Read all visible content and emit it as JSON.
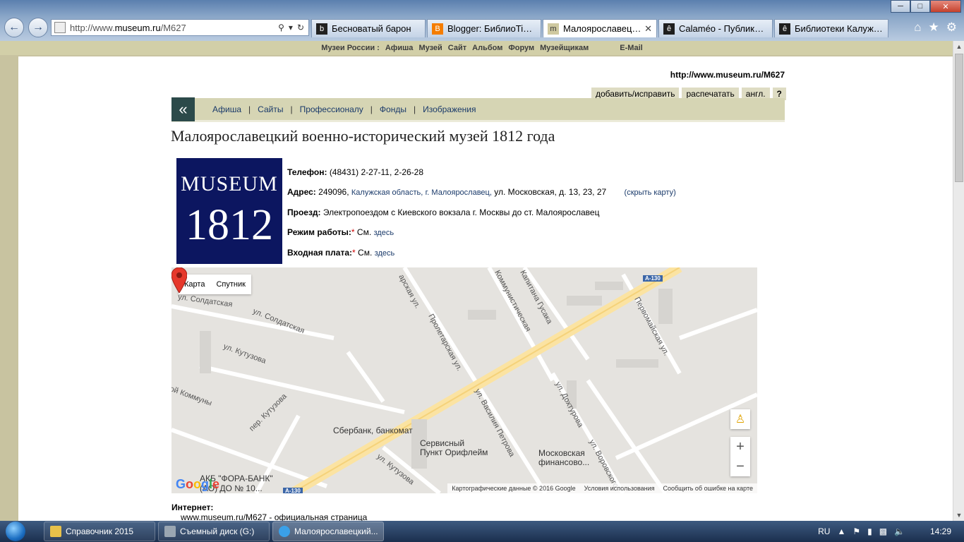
{
  "browser": {
    "address": {
      "prefix": "http://www.",
      "domain": "museum.ru",
      "path": "/M627"
    },
    "tabs": [
      {
        "label": "Бесноватый барон",
        "color": "#222222",
        "glyph": "b"
      },
      {
        "label": "Blogger: БиблиоTime -...",
        "color": "#f57d00",
        "glyph": "B"
      },
      {
        "label": "Малоярославецкий...",
        "color": "#cfc9a0",
        "glyph": "m",
        "active": true
      },
      {
        "label": "Calaméo - Публикации",
        "color": "#1f1f1f",
        "glyph": "ê"
      },
      {
        "label": "Библиотеки Калужско...",
        "color": "#1f1f1f",
        "glyph": "ê"
      }
    ]
  },
  "topmenu": {
    "items": [
      "Музеи России :",
      "Афиша",
      "Музей",
      "Сайт",
      "Альбом",
      "Форум",
      "Музейщикам"
    ],
    "email": "E-Mail"
  },
  "page": {
    "site_url": "http://www.museum.ru/M627",
    "actions": [
      "добавить/исправить",
      "распечатать",
      "англ.",
      "?"
    ],
    "nav": [
      "Афиша",
      "Сайты",
      "Профессионалу",
      "Фонды",
      "Изображения"
    ],
    "title": "Малоярославецкий военно-исторический музей 1812 года",
    "logo": {
      "line1": "MUSEUM",
      "line2": "1812"
    },
    "phone_label": "Телефон:",
    "phone": "(48431) 2-27-11, 2-26-28",
    "address_label": "Адрес:",
    "address_index": "249096,",
    "address_region": "Калужская область,",
    "address_city": "г. Малоярославец,",
    "address_street": "ул. Московская, д. 13, 23, 27",
    "hide_map": "(скрыть карту)",
    "route_label": "Проезд:",
    "route": "Электропоездом с Киевского вокзала г. Москвы до ст. Малоярославец",
    "hours_label": "Режим работы:",
    "hours_text": "См.",
    "hours_link": "здесь",
    "fee_label": "Входная плата:",
    "fee_text": "См.",
    "fee_link": "здесь",
    "internet_label": "Интернет:",
    "internet_link": "www.museum.ru/M627 - официальная страница"
  },
  "map": {
    "type_buttons": [
      "Карта",
      "Спутник"
    ],
    "labels": {
      "sberbank": "Сбербанк, банкомат",
      "service1": "Сервисный",
      "service2": "Пункт Орифлейм",
      "moscow1": "Московская",
      "moscow2": "финансово...",
      "fora1": "АКБ \"ФОРА-БАНК\"",
      "fora2": "(АО) ДО № 10..."
    },
    "streets": {
      "soldatskaya1": "ул. Солдатская",
      "soldatskaya2": "ул. Солдатская",
      "kutuzova1": "ул. Кутузова",
      "kutuzova_per": "пер. Кутузова",
      "kutuzova2": "ул. Кутузова",
      "kommuny": "ой Коммуны",
      "proletarskaya": "Пролетарская ул.",
      "proletarskaya_top": "арская ул.",
      "kommunisticheskaya": "Коммунистическая",
      "kapitana": "Капитана Гусака",
      "pervomayskaya": "Первомайская ул.",
      "petrova": "ул. Василия Петрова",
      "dokhturova": "ул. Дохтурова",
      "vorovskogo": "ул. Воровского"
    },
    "shields": {
      "a130_top": "А-130",
      "a130_bottom": "А-130"
    },
    "footer": [
      "Картографические данные © 2016 Google",
      "Условия использования",
      "Сообщить об ошибке на карте"
    ],
    "google": "Google"
  },
  "taskbar": {
    "items": [
      "Справочник 2015",
      "Съемный диск (G:)",
      "Малоярославецкий..."
    ],
    "lang": "RU",
    "time": "14:29"
  }
}
